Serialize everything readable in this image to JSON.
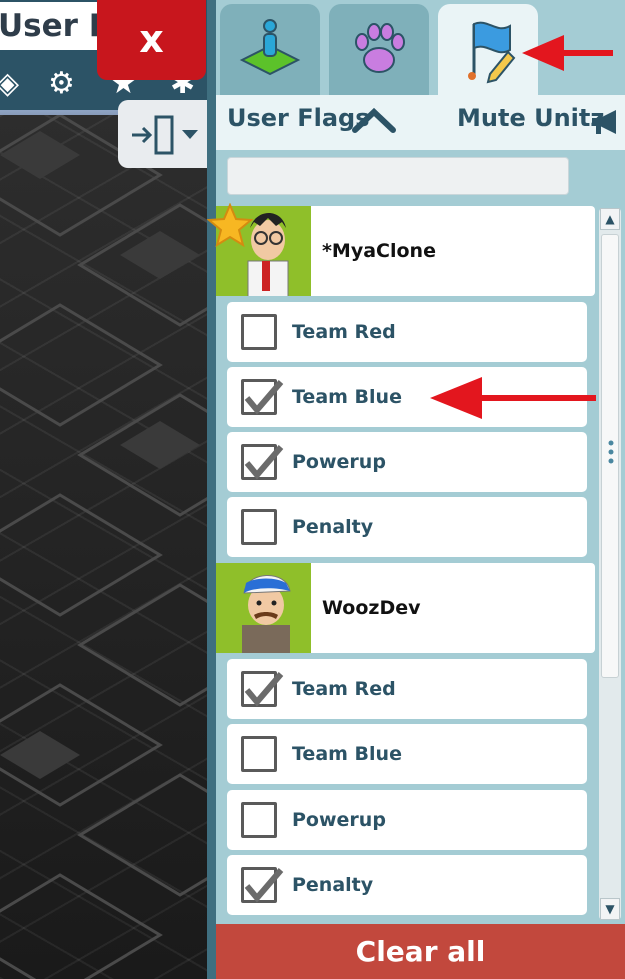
{
  "game": {
    "title": "User Fla",
    "close_label": "x"
  },
  "tabs": [
    {
      "icon": "room-user-icon",
      "active": false
    },
    {
      "icon": "paw-icon",
      "active": false
    },
    {
      "icon": "flag-edit-icon",
      "active": true
    }
  ],
  "panel": {
    "section_label": "User Flags",
    "mute_label": "Mute Unitz",
    "search_placeholder": "",
    "clear_all_label": "Clear all"
  },
  "users": [
    {
      "name": "*MyaClone",
      "flags": [
        {
          "label": "Team Red",
          "checked": false
        },
        {
          "label": "Team Blue",
          "checked": true
        },
        {
          "label": "Powerup",
          "checked": true
        },
        {
          "label": "Penalty",
          "checked": false
        }
      ]
    },
    {
      "name": "WoozDev",
      "flags": [
        {
          "label": "Team Red",
          "checked": true
        },
        {
          "label": "Team Blue",
          "checked": false
        },
        {
          "label": "Powerup",
          "checked": false
        },
        {
          "label": "Penalty",
          "checked": true
        }
      ]
    }
  ],
  "colors": {
    "panel_bg": "#a4ccd4",
    "text_primary": "#2c5366",
    "close_red": "#c8161d",
    "clear_all_bg": "#c2483d",
    "annotation_arrow": "#e3161e"
  }
}
